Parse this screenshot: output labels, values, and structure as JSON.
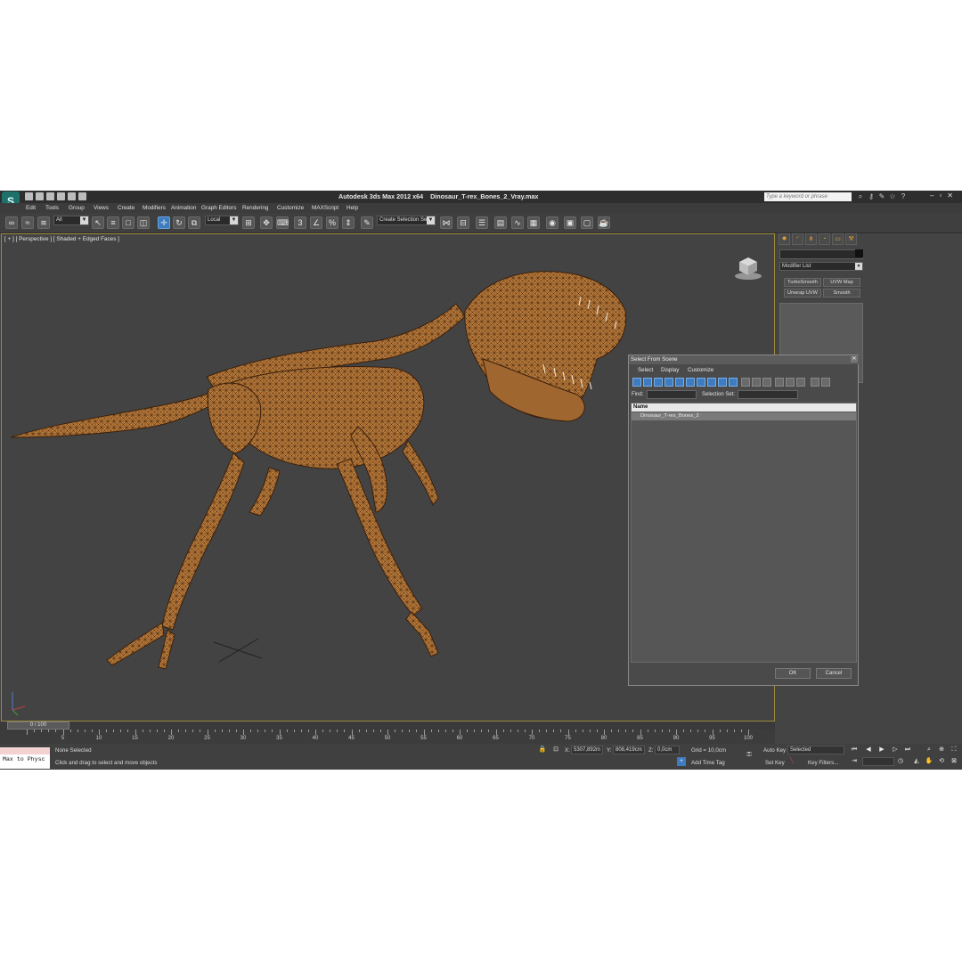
{
  "title_bar": {
    "app_title": "Autodesk 3ds Max  2012 x64",
    "file_name": "Dinosaur_T-rex_Bones_2_Vray.max",
    "search_placeholder": "Type a keyword or phrase"
  },
  "menu": {
    "items": [
      "Edit",
      "Tools",
      "Group",
      "Views",
      "Create",
      "Modifiers",
      "Animation",
      "Graph Editors",
      "Rendering",
      "Customize",
      "MAXScript",
      "Help"
    ]
  },
  "toolbar": {
    "filter_dropdown": "All",
    "coord_dropdown": "Local",
    "selection_set_dropdown": "Create Selection Se",
    "snap_label": "3",
    "percent_label": "%"
  },
  "viewport": {
    "label": "[ + ] [ Perspective ] [ Shaded + Edged Faces ]",
    "border_color": "#9b8a3b",
    "model_color": "#b8793a"
  },
  "command_panel": {
    "modifier_list": "Modifier List",
    "buttons": [
      "TurboSmooth",
      "UVW Map",
      "Unwrap UVW",
      "Smooth"
    ]
  },
  "dialog": {
    "title": "Select From Scene",
    "menu": [
      "Select",
      "Display",
      "Customize"
    ],
    "find_label": "Find:",
    "selection_set_label": "Selection Set:",
    "column_name": "Name",
    "items": [
      "Dinosaur_T-rex_Bones_2"
    ],
    "ok_label": "OK",
    "cancel_label": "Cancel"
  },
  "timeline": {
    "frame_counter": "0 / 100",
    "tick_labels": [
      "0",
      "5",
      "10",
      "15",
      "20",
      "25",
      "30",
      "35",
      "40",
      "45",
      "50",
      "55",
      "60",
      "65",
      "70",
      "75",
      "80",
      "85",
      "90",
      "95",
      "100"
    ]
  },
  "status": {
    "maxscript_listener": "Max to Physc",
    "selection": "None Selected",
    "prompt": "Click and drag to select and move objects",
    "x_label": "X:",
    "x_value": "5307,892m",
    "y_label": "Y:",
    "y_value": "808,419cm",
    "z_label": "Z:",
    "z_value": "0,0cm",
    "grid": "Grid = 10,0cm",
    "add_time_tag": "Add Time Tag",
    "auto_key": "Auto Key",
    "auto_key_mode": "Selected",
    "set_key": "Set Key",
    "key_filters": "Key Filters..."
  }
}
